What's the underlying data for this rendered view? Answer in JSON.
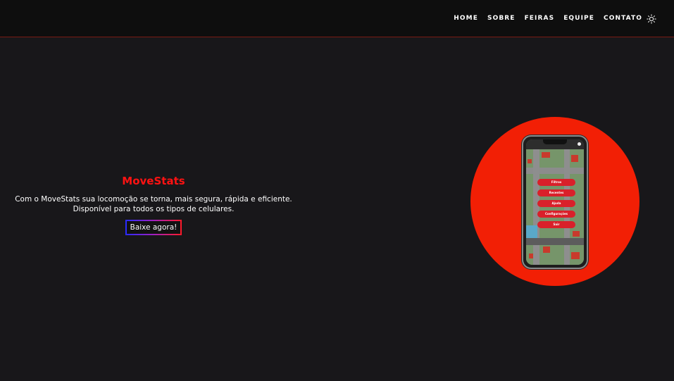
{
  "nav": {
    "items": [
      "HOME",
      "SOBRE",
      "FEIRAS",
      "EQUIPE",
      "CONTATO"
    ],
    "theme_icon": "sun-icon"
  },
  "hero": {
    "title": "MoveStats",
    "description_line1": "Com o MoveStats sua locomoção se torna, mais segura, rápida e eficiente.",
    "description_line2": "Disponível para todos os tipos de celulares.",
    "cta_label": "Baixe agora!"
  },
  "phone_app": {
    "menu_items": [
      "Filtros",
      "Recentes",
      "Ajuda",
      "Configurações",
      "Sair"
    ]
  },
  "colors": {
    "background": "#18171a",
    "navbar": "#0e0e0e",
    "accent_red": "#f21f05",
    "title_red": "#ff1212"
  }
}
